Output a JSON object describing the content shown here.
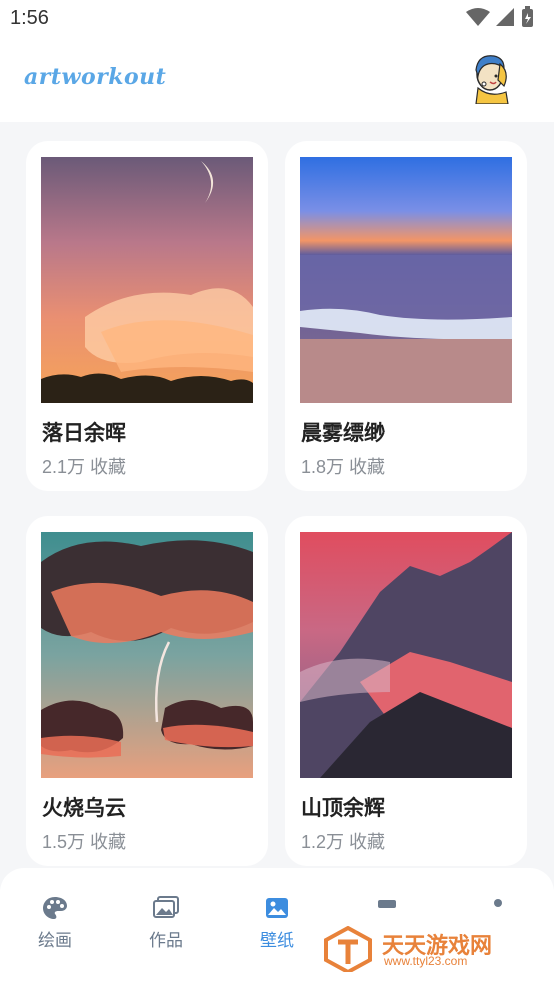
{
  "status_bar": {
    "time": "1:56"
  },
  "header": {
    "logo_text": "artworkout"
  },
  "cards": [
    {
      "title": "落日余晖",
      "meta": "2.1万 收藏"
    },
    {
      "title": "晨雾缥缈",
      "meta": "1.8万 收藏"
    },
    {
      "title": "火烧乌云",
      "meta": "1.5万 收藏"
    },
    {
      "title": "山顶余辉",
      "meta": "1.2万 收藏"
    }
  ],
  "bottom_nav": {
    "items": [
      {
        "label": "绘画",
        "icon": "palette-icon"
      },
      {
        "label": "作品",
        "icon": "gallery-icon"
      },
      {
        "label": "壁纸",
        "icon": "image-icon",
        "active": true
      },
      {
        "label": "",
        "icon": "partially-hidden-icon"
      },
      {
        "label": "",
        "icon": "profile-icon"
      }
    ]
  },
  "watermark": {
    "text": "天天游戏网",
    "url": "www.ttyl23.com"
  },
  "colors": {
    "accent": "#3d8ddf",
    "logo": "#5aa7e6",
    "watermark": "#e8823a"
  }
}
